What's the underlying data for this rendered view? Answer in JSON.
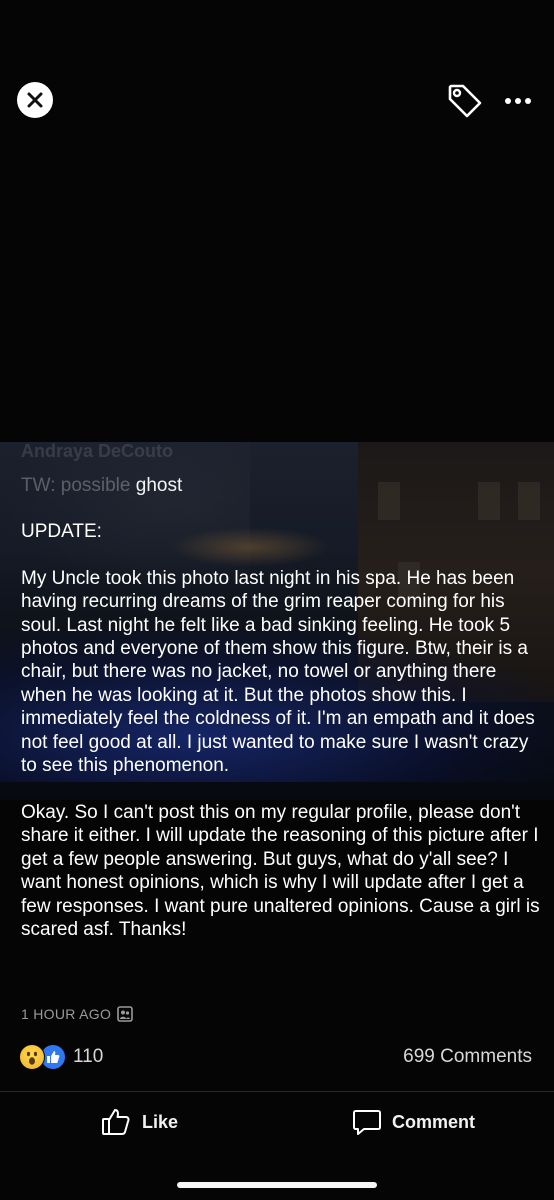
{
  "header": {
    "close_icon": "close-icon",
    "tag_icon": "tag-icon",
    "more_icon": "more-options-icon"
  },
  "post": {
    "author": "Andraya DeCouto",
    "subtitle_faded": "TW: possible",
    "subtitle_visible": " ghost",
    "body": "UPDATE:\n\nMy Uncle took this photo last night in his spa. He has been having recurring dreams of the grim reaper coming for his soul. Last night he felt like a bad sinking feeling. He took 5 photos and everyone of them show this figure. Btw, their is a chair, but there was no jacket, no towel or anything there when he was looking at it. But the photos show this. I immediately feel the coldness of it. I'm an empath and it does not feel good at all. I just wanted to make sure I wasn't crazy to see this phenomenon.\n\nOkay. So I can't post this on my regular profile, please don't share it either. I will update the reasoning of this picture after I get a few people answering. But guys, what do y'all see? I want honest opinions, which is why I will update after I get a few responses. I want pure unaltered opinions. Cause a girl is scared asf. Thanks!",
    "timestamp": "1 HOUR AGO",
    "privacy_icon": "friends-icon"
  },
  "engagement": {
    "reaction_icons": [
      "wow-reaction-icon",
      "like-reaction-icon"
    ],
    "reaction_count": "110",
    "comments_count": "699 Comments"
  },
  "actions": {
    "like_label": "Like",
    "comment_label": "Comment"
  },
  "colors": {
    "background": "#050505",
    "like_blue": "#2f78f2",
    "wow_yellow": "#f0b324"
  }
}
